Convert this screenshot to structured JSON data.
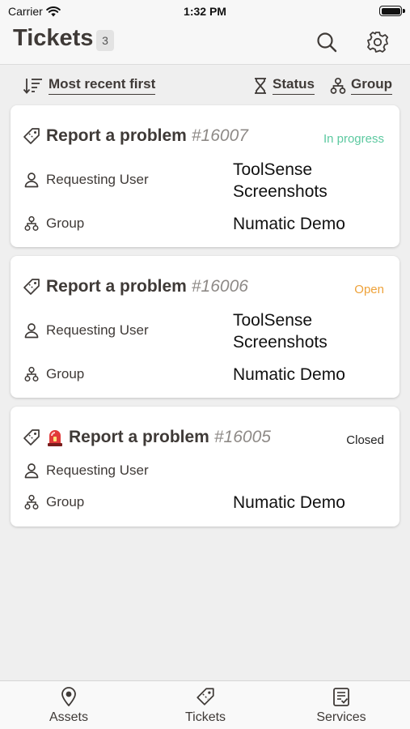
{
  "status_bar": {
    "carrier": "Carrier",
    "time": "1:32 PM"
  },
  "header": {
    "title": "Tickets",
    "count": "3"
  },
  "sort_bar": {
    "sort_label": "Most recent first",
    "status_label": "Status",
    "group_label": "Group"
  },
  "colors": {
    "in_progress": "#5cc9a0",
    "open": "#eea23a",
    "closed": "#222222"
  },
  "tickets": [
    {
      "title": "Report a problem",
      "id": "#16007",
      "status": "In progress",
      "requesting_user_label": "Requesting User",
      "requesting_user_value": "ToolSense Screenshots",
      "group_label": "Group",
      "group_value": "Numatic Demo"
    },
    {
      "title": "Report a problem",
      "id": "#16006",
      "status": "Open",
      "requesting_user_label": "Requesting User",
      "requesting_user_value": "ToolSense Screenshots",
      "group_label": "Group",
      "group_value": "Numatic Demo"
    },
    {
      "title": "Report a problem",
      "id": "#16005",
      "status": "Closed",
      "requesting_user_label": "Requesting User",
      "group_label": "Group",
      "group_value": "Numatic Demo",
      "icon": "alarm-icon"
    }
  ],
  "tab_bar": {
    "assets": "Assets",
    "tickets": "Tickets",
    "services": "Services"
  }
}
